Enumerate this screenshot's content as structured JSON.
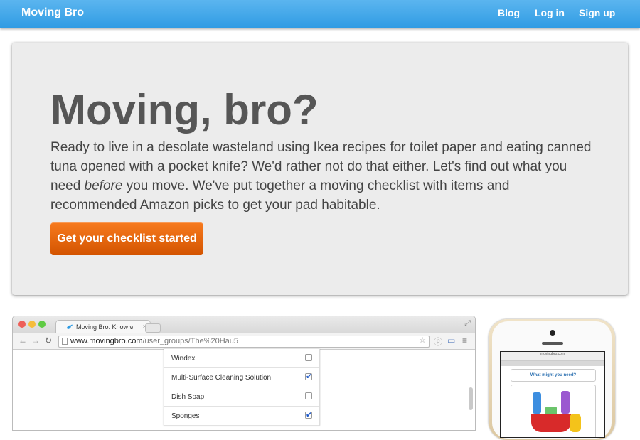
{
  "navbar": {
    "brand": "Moving Bro",
    "links": [
      "Blog",
      "Log in",
      "Sign up"
    ]
  },
  "hero": {
    "title": "Moving, bro?",
    "lead_1": "Ready to live in a desolate wasteland using Ikea recipes for toilet paper and eating canned tuna opened with a pocket knife? We'd rather not do that either. Let's find out what you need ",
    "lead_emphasis": "before",
    "lead_2": " you move. We've put together a moving checklist with items and recommended Amazon picks to get your pad habitable.",
    "cta": "Get your checklist started"
  },
  "browser_screenshot": {
    "tab_title": "Moving Bro: Know what yo",
    "url_domain": "www.movingbro.com",
    "url_path": "/user_groups/The%20Hau5",
    "checklist": [
      {
        "label": "Windex",
        "checked": false
      },
      {
        "label": "Multi-Surface Cleaning Solution",
        "checked": true
      },
      {
        "label": "Dish Soap",
        "checked": false
      },
      {
        "label": "Sponges",
        "checked": true
      }
    ]
  },
  "phone_screenshot": {
    "address": "movingbro.com",
    "card_title": "What might you need?"
  },
  "colors": {
    "navbar": "#2f9be3",
    "hero_bg": "#ececec",
    "cta": "#e5620e",
    "checkbox_check": "#1a56c8"
  }
}
